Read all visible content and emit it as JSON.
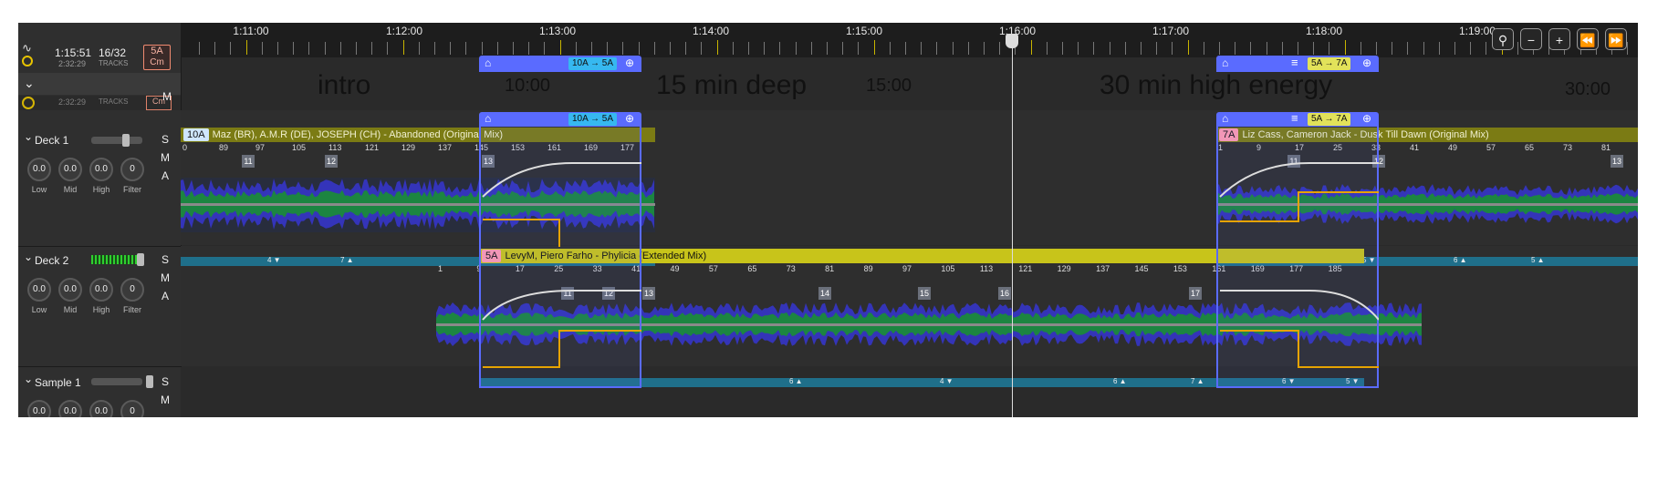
{
  "header": {
    "elapsed": "1:15:51",
    "remaining": "2:32:29",
    "track_count": "16/32",
    "tracks_label": "TRACKS",
    "key_top": "5A",
    "key_bottom": "Cm",
    "controls": [
      "guitar-pick-icon",
      "minus-icon",
      "plus-icon",
      "rewind-icon",
      "fast-forward-icon"
    ]
  },
  "timeline": {
    "labels": [
      "1:11:00",
      "1:12:00",
      "1:13:00",
      "1:14:00",
      "1:15:00",
      "1:16:00",
      "1:17:00",
      "1:18:00",
      "1:19:00"
    ]
  },
  "segments": [
    {
      "title": "intro",
      "time": "10:00",
      "color": "#f7a93b"
    },
    {
      "title": "15 min deep",
      "time": "15:00",
      "color": "#a7ef4b"
    },
    {
      "title": "30 min high energy",
      "time": "30:00",
      "color": "#0aa6e0"
    }
  ],
  "ghost": {
    "remaining": "2:32:29",
    "tracks": "TRACKS",
    "key": "Cm"
  },
  "transitions": {
    "first": {
      "key_change": "10A → 5A"
    },
    "second": {
      "key_change": "5A → 7A"
    }
  },
  "decks": [
    {
      "name": "Deck 1",
      "knobs": [
        {
          "value": "0.0",
          "label": "Low"
        },
        {
          "value": "0.0",
          "label": "Mid"
        },
        {
          "value": "0.0",
          "label": "High"
        },
        {
          "value": "0",
          "label": "Filter"
        }
      ],
      "buttons": [
        "S",
        "M",
        "A"
      ],
      "clips": [
        {
          "key": "10A",
          "key_color": "#cfe6ff",
          "title": "Maz (BR), A.M.R (DE), JOSEPH (CH) - Abandoned (Original Mix)",
          "head_color": "#7b7b14",
          "beats": [
            "0",
            "89",
            "97",
            "105",
            "113",
            "121",
            "129",
            "137",
            "145",
            "153",
            "161",
            "169",
            "177"
          ],
          "cues": [
            "11",
            "12",
            "13"
          ],
          "bar_marks": [
            "4 ▼",
            "7 ▲",
            "6 ▼",
            "5 ▼"
          ]
        },
        {
          "key": "7A",
          "key_color": "#ff9bb1",
          "title": "Liz Cass, Cameron Jack - Dusk Till Dawn (Original Mix)",
          "head_color": "#7b7b14",
          "beats": [
            "1",
            "9",
            "17",
            "25",
            "33",
            "41",
            "49",
            "57",
            "65",
            "73",
            "81"
          ],
          "cues": [
            "11",
            "12",
            "13"
          ],
          "bar_marks": [
            "6 ▲",
            "5 ▼",
            "6 ▲",
            "5 ▲"
          ]
        }
      ]
    },
    {
      "name": "Deck 2",
      "knobs": [
        {
          "value": "0.0",
          "label": "Low"
        },
        {
          "value": "0.0",
          "label": "Mid"
        },
        {
          "value": "0.0",
          "label": "High"
        },
        {
          "value": "0",
          "label": "Filter"
        }
      ],
      "buttons": [
        "S",
        "M",
        "A"
      ],
      "clips": [
        {
          "key": "5A",
          "key_color": "#ff9bb1",
          "title": "LevyM, Piero Farho - Phylicia (Extended Mix)",
          "head_color": "#c8c41a",
          "beats": [
            "1",
            "9",
            "17",
            "25",
            "33",
            "41",
            "49",
            "57",
            "65",
            "73",
            "81",
            "89",
            "97",
            "105",
            "113",
            "121",
            "129",
            "137",
            "145",
            "153",
            "161",
            "169",
            "177",
            "185"
          ],
          "cues": [
            "11",
            "12",
            "13",
            "14",
            "15",
            "16",
            "17"
          ],
          "bar_marks": [
            "6 ▲",
            "4 ▼",
            "6 ▲",
            "7 ▲",
            "6 ▼",
            "5 ▼"
          ]
        }
      ]
    }
  ],
  "sample": {
    "name": "Sample 1",
    "knobs": [
      {
        "value": "0.0"
      },
      {
        "value": "0.0"
      },
      {
        "value": "0.0"
      },
      {
        "value": "0"
      }
    ],
    "buttons": [
      "S",
      "M"
    ]
  }
}
